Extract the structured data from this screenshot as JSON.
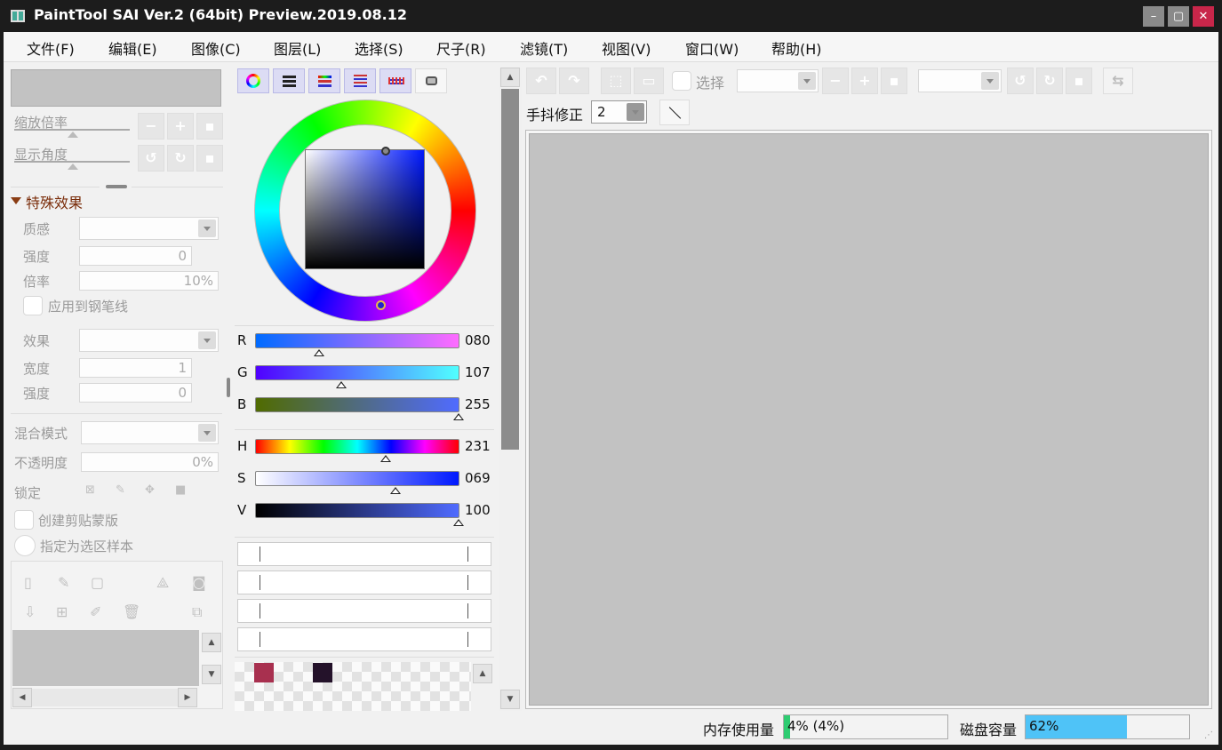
{
  "title": "PaintTool SAI Ver.2 (64bit) Preview.2019.08.12",
  "window_controls": {
    "minimize": "–",
    "maximize": "▢",
    "close": "✕"
  },
  "menu": [
    "文件(F)",
    "编辑(E)",
    "图像(C)",
    "图层(L)",
    "选择(S)",
    "尺子(R)",
    "滤镜(T)",
    "视图(V)",
    "窗口(W)",
    "帮助(H)"
  ],
  "navigator": {
    "zoom_label": "缩放倍率",
    "angle_label": "显示角度"
  },
  "layer_props": {
    "section_title": "特殊效果",
    "texture_label": "质感",
    "strength_label": "强度",
    "strength_value": "0",
    "scale_label": "倍率",
    "scale_value": "10%",
    "apply_pen_label": "应用到钢笔线",
    "effect_label": "效果",
    "width_label": "宽度",
    "width_value": "1",
    "strength2_label": "强度",
    "strength2_value": "0",
    "blend_label": "混合模式",
    "opacity_label": "不透明度",
    "opacity_value": "0%",
    "lock_label": "锁定",
    "clip_label": "创建剪贴蒙版",
    "select_sample_label": "指定为选区样本"
  },
  "color": {
    "rgb": [
      {
        "label": "R",
        "value": "080",
        "level": 0.31
      },
      {
        "label": "G",
        "value": "107",
        "level": 0.42
      },
      {
        "label": "B",
        "value": "255",
        "level": 1.0
      }
    ],
    "hsv": [
      {
        "label": "H",
        "value": "231",
        "level": 0.64
      },
      {
        "label": "S",
        "value": "069",
        "level": 0.69
      },
      {
        "label": "V",
        "value": "100",
        "level": 1.0
      }
    ],
    "swatches": [
      "#a8304f",
      "#24122a"
    ],
    "accent": "#5a6cff"
  },
  "toolbar": {
    "select_label": "选择",
    "stabilizer_label": "手抖修正",
    "stabilizer_value": "2"
  },
  "status": {
    "memory_label": "内存使用量",
    "memory_value": "4% (4%)",
    "memory_level": 0.04,
    "disk_label": "磁盘容量",
    "disk_value": "62%",
    "disk_level": 0.62
  }
}
